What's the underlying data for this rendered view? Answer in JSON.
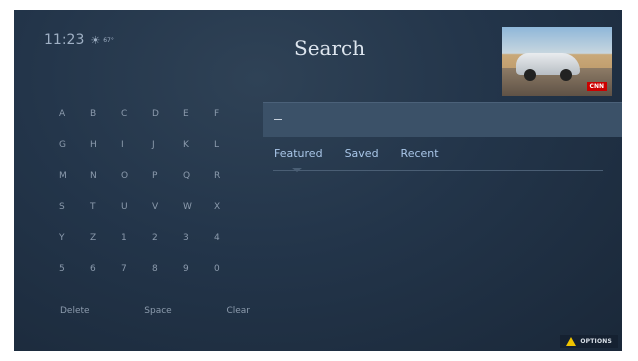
{
  "status": {
    "time": "11:23",
    "weather_icon": "sun-icon",
    "temperature": "67°"
  },
  "title": "Search",
  "preview": {
    "channel_badge": "CNN"
  },
  "keyboard": {
    "rows": [
      [
        "A",
        "B",
        "C",
        "D",
        "E",
        "F"
      ],
      [
        "G",
        "H",
        "I",
        "J",
        "K",
        "L"
      ],
      [
        "M",
        "N",
        "O",
        "P",
        "Q",
        "R"
      ],
      [
        "S",
        "T",
        "U",
        "V",
        "W",
        "X"
      ],
      [
        "Y",
        "Z",
        "1",
        "2",
        "3",
        "4"
      ],
      [
        "5",
        "6",
        "7",
        "8",
        "9",
        "0"
      ]
    ],
    "actions": [
      "Delete",
      "Space",
      "Clear"
    ]
  },
  "search": {
    "value": ""
  },
  "tabs": [
    {
      "label": "Featured"
    },
    {
      "label": "Saved"
    },
    {
      "label": "Recent"
    }
  ],
  "options": {
    "label": "OPTIONS",
    "icon": "triangle-icon",
    "icon_color": "#f0c400"
  }
}
